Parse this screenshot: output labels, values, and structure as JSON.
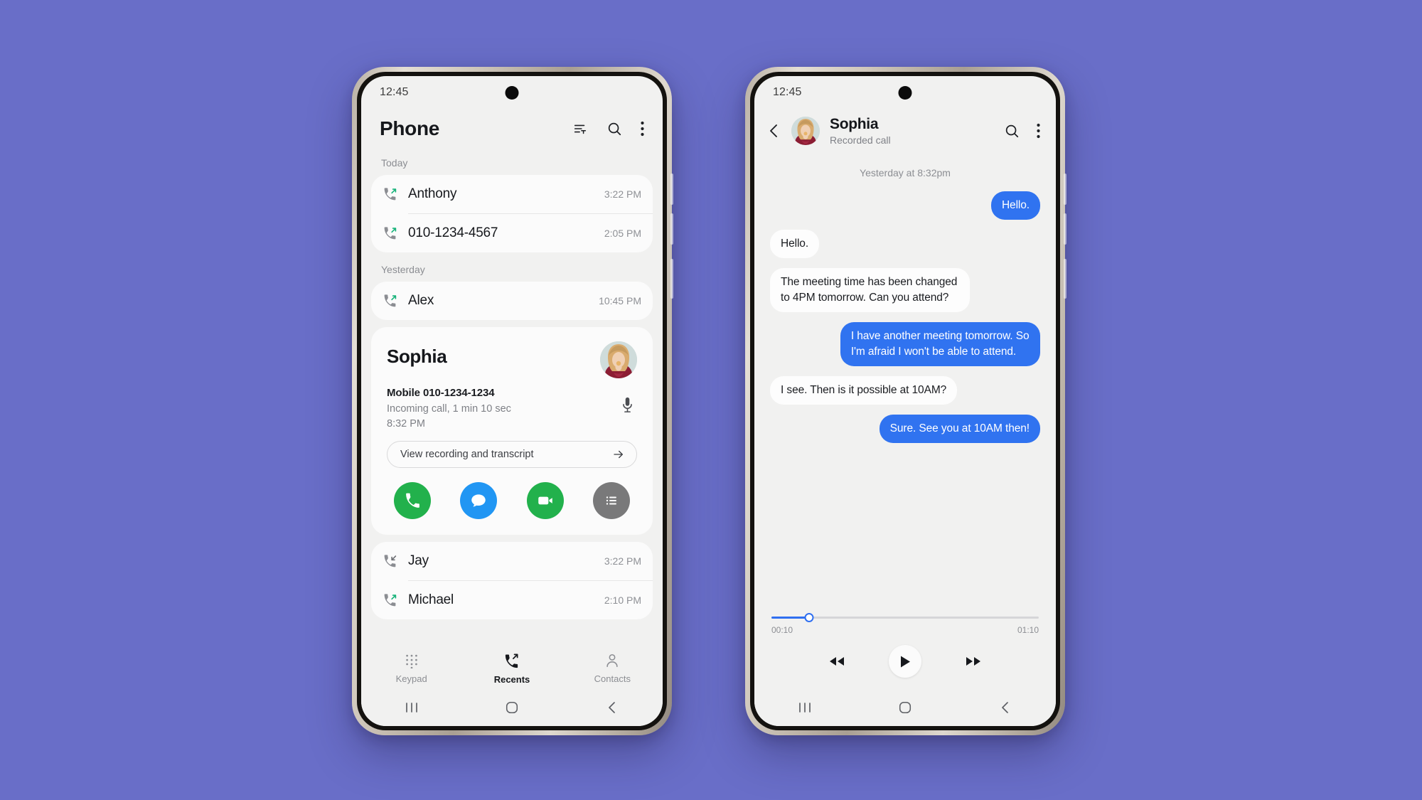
{
  "background_color": "#696ec8",
  "left_phone": {
    "status_bar": {
      "time": "12:45"
    },
    "app_bar": {
      "title": "Phone",
      "sort_icon": "sort-filter-icon",
      "search_icon": "search-icon",
      "more_icon": "more-vertical-icon"
    },
    "sections": [
      {
        "label": "Today",
        "calls": [
          {
            "name": "Anthony",
            "time": "3:22 PM",
            "type": "outgoing"
          },
          {
            "name": "010-1234-4567",
            "time": "2:05 PM",
            "type": "outgoing"
          }
        ]
      },
      {
        "label": "Yesterday",
        "calls": [
          {
            "name": "Alex",
            "time": "10:45 PM",
            "type": "outgoing"
          }
        ]
      }
    ],
    "expanded_call": {
      "name": "Sophia",
      "number_label": "Mobile",
      "number": "010-1234-1234",
      "detail": "Incoming call, 1 min 10 sec",
      "time": "8:32 PM",
      "mic_icon": "microphone-icon",
      "transcript_label": "View recording and transcript",
      "transcript_arrow_icon": "arrow-right-icon",
      "actions": [
        {
          "name": "call-action",
          "icon": "phone-icon",
          "color": "#22b14c"
        },
        {
          "name": "message-action",
          "icon": "message-bubble-icon",
          "color": "#2196f3"
        },
        {
          "name": "video-call-action",
          "icon": "video-camera-icon",
          "color": "#22b14c"
        },
        {
          "name": "details-action",
          "icon": "list-icon",
          "color": "#79797a"
        }
      ]
    },
    "more_calls": [
      {
        "name": "Jay",
        "time": "3:22 PM",
        "type": "missed"
      },
      {
        "name": "Michael",
        "time": "2:10 PM",
        "type": "outgoing"
      }
    ],
    "tabs": [
      {
        "label": "Keypad",
        "icon": "keypad-icon",
        "active": false
      },
      {
        "label": "Recents",
        "icon": "recent-calls-icon",
        "active": true
      },
      {
        "label": "Contacts",
        "icon": "person-icon",
        "active": false
      }
    ],
    "nav_bar": [
      {
        "name": "recents-nav-button",
        "icon": "three-bars-icon"
      },
      {
        "name": "home-nav-button",
        "icon": "circle-icon"
      },
      {
        "name": "back-nav-button",
        "icon": "chevron-left-icon"
      }
    ]
  },
  "right_phone": {
    "status_bar": {
      "time": "12:45"
    },
    "conv_bar": {
      "back_icon": "chevron-left-icon",
      "name": "Sophia",
      "subtitle": "Recorded call",
      "search_icon": "search-icon",
      "more_icon": "more-vertical-icon"
    },
    "timestamp": "Yesterday at 8:32pm",
    "messages": [
      {
        "side": "out",
        "text": "Hello."
      },
      {
        "side": "in",
        "text": "Hello."
      },
      {
        "side": "in",
        "text": "The meeting time has been changed to 4PM tomorrow. Can you attend?"
      },
      {
        "side": "out",
        "text": "I have another meeting tomorrow. So I'm afraid I won't be able to attend."
      },
      {
        "side": "in",
        "text": "I see. Then is it possible at 10AM?"
      },
      {
        "side": "out",
        "text": "Sure. See you at 10AM then!"
      }
    ],
    "player": {
      "current_time": "00:10",
      "total_time": "01:10",
      "progress_percent": 14,
      "rewind_icon": "rewind-icon",
      "play_icon": "play-icon",
      "forward_icon": "fast-forward-icon"
    },
    "nav_bar": [
      {
        "name": "recents-nav-button",
        "icon": "three-bars-icon"
      },
      {
        "name": "home-nav-button",
        "icon": "circle-icon"
      },
      {
        "name": "back-nav-button",
        "icon": "chevron-left-icon"
      }
    ]
  }
}
